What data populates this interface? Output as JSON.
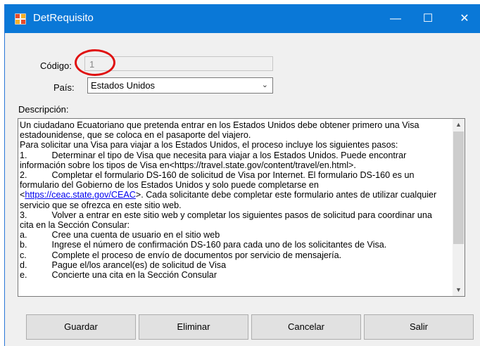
{
  "window": {
    "title": "DetRequisito",
    "icon": "form-app-icon",
    "controls": {
      "minimize": "—",
      "maximize": "☐",
      "close": "✕"
    }
  },
  "form": {
    "codigo_label": "Código:",
    "codigo_value": "1",
    "pais_label": "País:",
    "pais_value": "Estados Unidos",
    "descripcion_label": "Descripción:"
  },
  "description": {
    "lines": [
      "Un ciudadano Ecuatoriano que pretenda entrar en los Estados Unidos debe obtener primero una Visa",
      "estadounidense, que se coloca en el pasaporte del viajero.",
      "Para solicitar una Visa para viajar a los Estados Unidos, el proceso incluye los siguientes pasos:",
      "1.\t     Determinar el tipo de Visa que necesita para viajar a los Estados Unidos. Puede encontrar",
      "información sobre los tipos de Visa en<https://travel.state.gov/content/travel/en.html>.",
      "2.\t     Completar el formulario DS-160 de solicitud de Visa por Internet. El formulario DS-160 es un",
      "formulario del Gobierno de los Estados Unidos y solo puede completarse en"
    ],
    "link_prefix": "<",
    "link": "https://ceac.state.gov/CEAC",
    "link_suffix": ">. Cada solicitante debe completar este formulario antes de utilizar cualquier",
    "lines2": [
      "servicio que se ofrezca en este sitio web.",
      "3.\t     Volver a entrar en este sitio web y completar los siguientes pasos de solicitud para coordinar una",
      "cita en la Sección Consular:",
      "a.\t     Cree una cuenta de usuario en el sitio web",
      "b.\t     Ingrese el número de confirmación DS-160 para cada uno de los solicitantes de Visa.",
      "c.\t     Complete el proceso de envío de documentos por servicio de mensajería.",
      "d.\t     Pague el/los arancel(es) de solicitud de Visa",
      "e.\t     Concierte una cita en la Sección Consular"
    ]
  },
  "buttons": {
    "guardar": "Guardar",
    "eliminar": "Eliminar",
    "cancelar": "Cancelar",
    "salir": "Salir"
  }
}
